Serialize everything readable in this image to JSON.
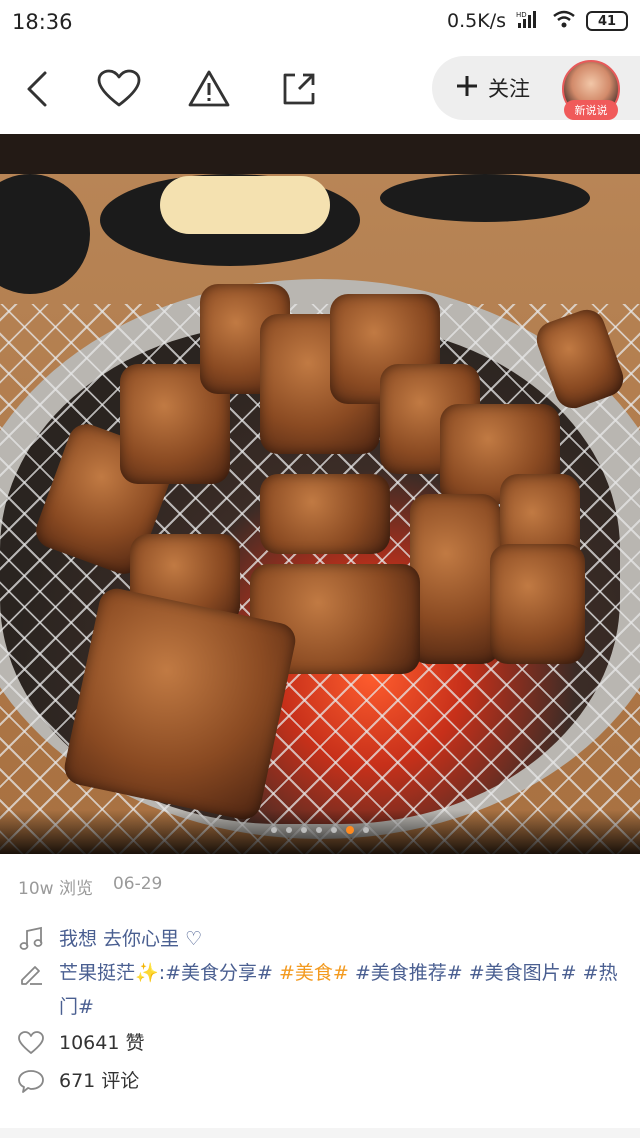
{
  "status": {
    "time": "18:36",
    "net_speed": "0.5K/s",
    "battery": "41"
  },
  "nav": {
    "follow_label": "关注",
    "avatar_tag": "新说说"
  },
  "photo": {
    "page_count": 7,
    "active_index": 5
  },
  "meta": {
    "views": "10w 浏览",
    "date": "06-29"
  },
  "song": "我想  去你心里 ♡",
  "description": {
    "author": "芒果挺茫",
    "author_emoji": "✨",
    "separator": ":",
    "tags": [
      {
        "text": "#美食分享#",
        "highlight": false
      },
      {
        "text": "#美食#",
        "highlight": true
      },
      {
        "text": "#美食推荐#",
        "highlight": false
      },
      {
        "text": "#美食图片#",
        "highlight": false
      },
      {
        "text": "#热门#",
        "highlight": false
      }
    ]
  },
  "likes": "10641 赞",
  "comments": "671 评论",
  "colors": {
    "link": "#4a5f91",
    "highlight_tag": "#f39a1f",
    "active_dot": "#ff8a1f",
    "avatar_tag_bg": "#f05a5a"
  },
  "icons": [
    "back-icon",
    "heart-icon",
    "warning-icon",
    "share-icon",
    "plus-icon",
    "music-note-icon",
    "pencil-icon",
    "like-icon",
    "comment-icon",
    "signal-icon",
    "wifi-icon",
    "battery-icon"
  ]
}
